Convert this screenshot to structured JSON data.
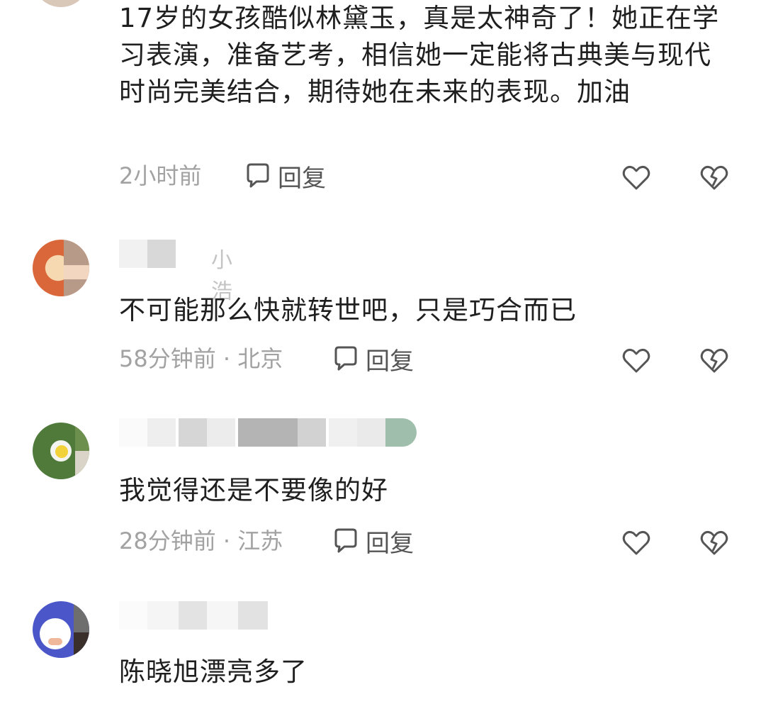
{
  "comments": [
    {
      "text": "17岁的女孩酷似林黛玉，真是太神奇了！她正在学习表演，准备艺考，相信她一定能将古典美与现代时尚完美结合，期待她在未来的表现。加油",
      "time": "2小时前",
      "location": "",
      "reply_label": "回复"
    },
    {
      "name_partial": "小浩",
      "text": "不可能那么快就转世吧，只是巧合而已",
      "time": "58分钟前",
      "location": "北京",
      "reply_label": "回复"
    },
    {
      "text": "我觉得还是不要像的好",
      "time": "28分钟前",
      "location": "江苏",
      "reply_label": "回复"
    },
    {
      "text": "陈晓旭漂亮多了"
    }
  ],
  "meta_separator": " · ",
  "colors": {
    "text": "#1f1f1f",
    "meta": "#a2a2a2",
    "icon": "#555555"
  },
  "icons": [
    "comment-bubble-icon",
    "heart-icon",
    "broken-heart-icon"
  ]
}
